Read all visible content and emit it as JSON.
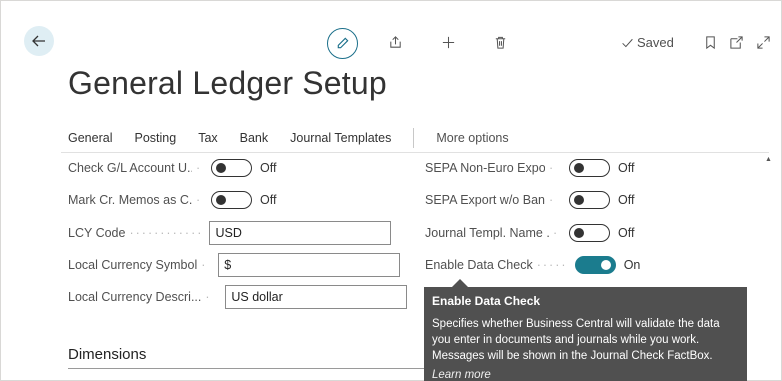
{
  "header": {
    "back_icon": "arrow-left-icon",
    "toolbar_icons": [
      "pencil-icon",
      "share-icon",
      "plus-icon",
      "trash-icon",
      "bookmark-icon",
      "open-new-window-icon",
      "expand-icon"
    ],
    "saved_label": "Saved"
  },
  "page": {
    "title": "General Ledger Setup"
  },
  "tabs": [
    "General",
    "Posting",
    "Tax",
    "Bank",
    "Journal Templates"
  ],
  "more_options": "More options",
  "left_fields": [
    {
      "label": "Check G/L Account U...",
      "type": "toggle",
      "value": "Off"
    },
    {
      "label": "Mark Cr. Memos as C...",
      "type": "toggle",
      "value": "Off"
    },
    {
      "label": "LCY Code",
      "type": "input",
      "value": "USD"
    },
    {
      "label": "Local Currency Symbol",
      "type": "input",
      "value": "$"
    },
    {
      "label": "Local Currency Descri...",
      "type": "input",
      "value": "US dollar"
    }
  ],
  "right_fields": [
    {
      "label": "SEPA Non-Euro Export",
      "type": "toggle",
      "value": "Off"
    },
    {
      "label": "SEPA Export w/o Ban...",
      "type": "toggle",
      "value": "Off"
    },
    {
      "label": "Journal Templ. Name ...",
      "type": "toggle",
      "value": "Off"
    },
    {
      "label": "Enable Data Check",
      "type": "toggle",
      "value": "On"
    }
  ],
  "section": {
    "title": "Dimensions"
  },
  "tooltip": {
    "title": "Enable Data Check",
    "body": "Specifies whether Business Central will validate the data you enter in documents and journals while you work. Messages will be shown in the Journal Check FactBox.",
    "link": "Learn more"
  },
  "colors": {
    "accent": "#1b7c8e",
    "tooltip_bg": "#505050"
  }
}
